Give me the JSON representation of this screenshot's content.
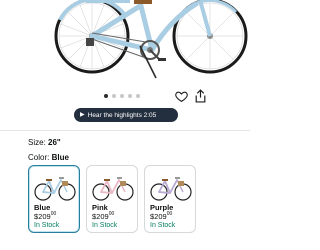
{
  "carousel": {
    "image_alt": "light blue step-through cruiser bicycle",
    "dot_count": 5,
    "active_index": 0
  },
  "actions": {
    "favorite_icon": "heart-outline-icon",
    "share_icon": "share-upload-icon"
  },
  "highlights": {
    "label": "Hear the highlights 2:05",
    "icon": "play-icon"
  },
  "size": {
    "label": "Size:",
    "value": "26\""
  },
  "color": {
    "label": "Color:",
    "value": "Blue"
  },
  "variants": [
    {
      "name": "Blue",
      "price_whole": "209",
      "price_cents": "00",
      "currency": "$",
      "stock": "In Stock",
      "frame_color": "#a9cde3",
      "selected": true
    },
    {
      "name": "Pink",
      "price_whole": "209",
      "price_cents": "00",
      "currency": "$",
      "stock": "In Stock",
      "frame_color": "#eab7c4",
      "selected": false
    },
    {
      "name": "Purple",
      "price_whole": "209",
      "price_cents": "00",
      "currency": "$",
      "stock": "In Stock",
      "frame_color": "#b9a9d3",
      "selected": false
    }
  ],
  "colors": {
    "accent": "#2a7e9c",
    "in_stock": "#067d62",
    "pill_bg": "#232f3e",
    "bike_frame": "#a9cde3",
    "saddle": "#8b5a2b"
  }
}
